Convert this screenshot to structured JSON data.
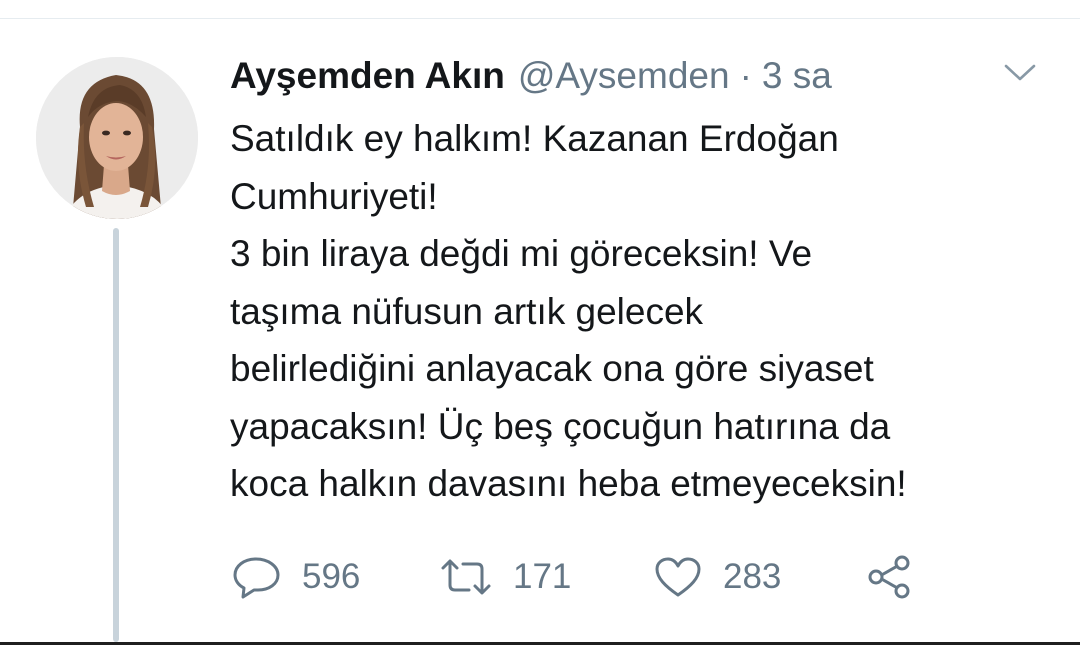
{
  "tweet": {
    "author": {
      "display_name": "Ayşemden Akın",
      "handle": "@Aysemden",
      "separator": "·",
      "timestamp": "3 sa"
    },
    "text_lines": [
      "Satıldık ey halkım! Kazanan Erdoğan",
      "Cumhuriyeti!",
      "3 bin liraya değdi mi göreceksin! Ve",
      "taşıma nüfusun artık gelecek",
      "belirlediğini anlayacak ona göre siyaset",
      "yapacaksın! Üç beş çocuğun hatırına da",
      "koca halkın davasını heba etmeyeceksin!"
    ],
    "stats": {
      "replies": "596",
      "retweets": "171",
      "likes": "283"
    }
  },
  "icons": {
    "caret": "chevron-down-icon",
    "reply": "reply-icon",
    "retweet": "retweet-icon",
    "like": "heart-icon",
    "share": "share-icon"
  },
  "colors": {
    "text_primary": "#14171a",
    "text_secondary": "#657786",
    "icon": "#657786",
    "thread_line": "#c8d3db",
    "divider": "#e6ecf0"
  }
}
